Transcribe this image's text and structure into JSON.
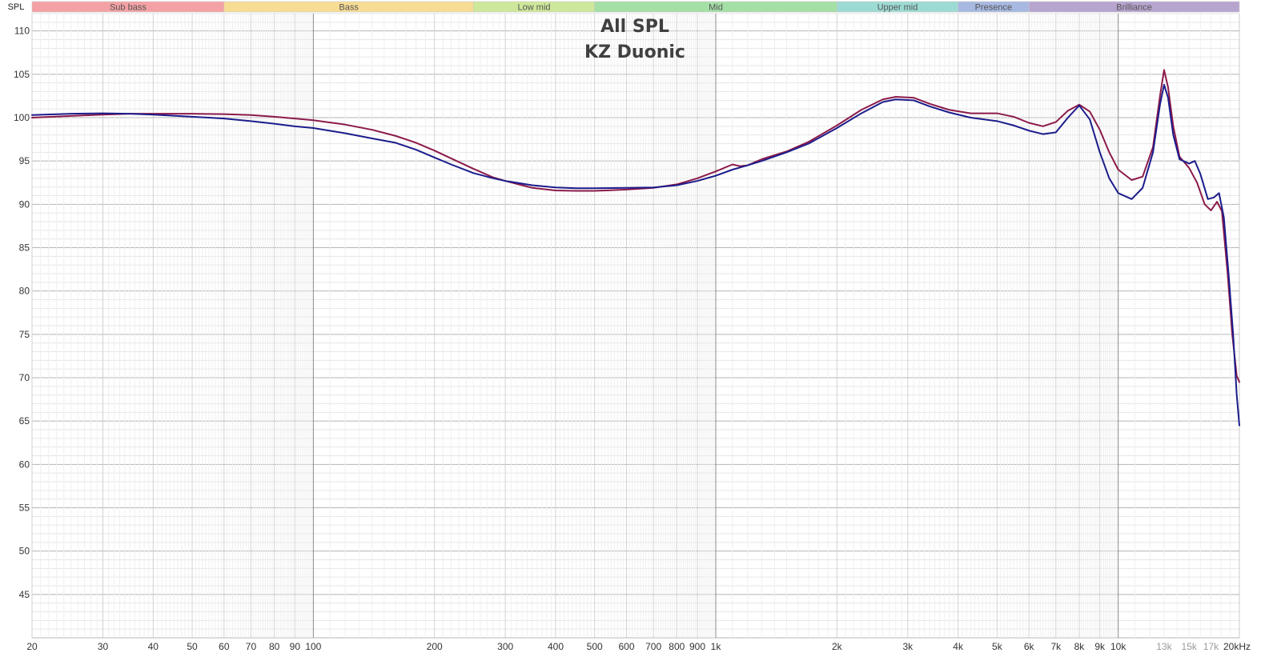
{
  "chart_data": {
    "type": "line",
    "title": "All SPL",
    "subtitle": "KZ Duonic",
    "ylabel": "SPL",
    "x_scale": "log",
    "xlim": [
      20,
      20000
    ],
    "ylim": [
      40,
      112
    ],
    "grid": true,
    "y_ticks": [
      45,
      50,
      55,
      60,
      65,
      70,
      75,
      80,
      85,
      90,
      95,
      100,
      105,
      110
    ],
    "x_ticks": [
      {
        "value": 20,
        "label": "20"
      },
      {
        "value": 30,
        "label": "30"
      },
      {
        "value": 40,
        "label": "40"
      },
      {
        "value": 50,
        "label": "50"
      },
      {
        "value": 60,
        "label": "60"
      },
      {
        "value": 70,
        "label": "70"
      },
      {
        "value": 80,
        "label": "80"
      },
      {
        "value": 90,
        "label": "90"
      },
      {
        "value": 100,
        "label": "100"
      },
      {
        "value": 200,
        "label": "200"
      },
      {
        "value": 300,
        "label": "300"
      },
      {
        "value": 400,
        "label": "400"
      },
      {
        "value": 500,
        "label": "500"
      },
      {
        "value": 600,
        "label": "600"
      },
      {
        "value": 700,
        "label": "700"
      },
      {
        "value": 800,
        "label": "800"
      },
      {
        "value": 900,
        "label": "900"
      },
      {
        "value": 1000,
        "label": "1k"
      },
      {
        "value": 2000,
        "label": "2k"
      },
      {
        "value": 3000,
        "label": "3k"
      },
      {
        "value": 4000,
        "label": "4k"
      },
      {
        "value": 5000,
        "label": "5k"
      },
      {
        "value": 6000,
        "label": "6k"
      },
      {
        "value": 7000,
        "label": "7k"
      },
      {
        "value": 8000,
        "label": "8k"
      },
      {
        "value": 9000,
        "label": "9k"
      },
      {
        "value": 10000,
        "label": "10k"
      },
      {
        "value": 13000,
        "label": "13k",
        "faint": true
      },
      {
        "value": 15000,
        "label": "15k",
        "faint": true
      },
      {
        "value": 17000,
        "label": "17k",
        "faint": true
      },
      {
        "value": 20000,
        "label": "20kHz"
      }
    ],
    "bands": [
      {
        "name": "Sub bass",
        "from": 20,
        "to": 60,
        "color": "#f4a1a5"
      },
      {
        "name": "Bass",
        "from": 60,
        "to": 250,
        "color": "#f7dc94"
      },
      {
        "name": "Low mid",
        "from": 250,
        "to": 500,
        "color": "#cde89a"
      },
      {
        "name": "Mid",
        "from": 500,
        "to": 2000,
        "color": "#a4dfa6"
      },
      {
        "name": "Upper mid",
        "from": 2000,
        "to": 4000,
        "color": "#9cdbd3"
      },
      {
        "name": "Presence",
        "from": 4000,
        "to": 6000,
        "color": "#a7b8e1"
      },
      {
        "name": "Brilliance",
        "from": 6000,
        "to": 20000,
        "color": "#b7a4cf"
      }
    ],
    "series": [
      {
        "color": "#8b1a4a",
        "points": [
          [
            20,
            100.0
          ],
          [
            25,
            100.2
          ],
          [
            30,
            100.35
          ],
          [
            35,
            100.45
          ],
          [
            40,
            100.45
          ],
          [
            50,
            100.45
          ],
          [
            60,
            100.4
          ],
          [
            70,
            100.3
          ],
          [
            80,
            100.1
          ],
          [
            90,
            99.9
          ],
          [
            100,
            99.7
          ],
          [
            120,
            99.2
          ],
          [
            140,
            98.6
          ],
          [
            160,
            97.9
          ],
          [
            180,
            97.1
          ],
          [
            200,
            96.2
          ],
          [
            220,
            95.3
          ],
          [
            250,
            94.1
          ],
          [
            280,
            93.1
          ],
          [
            300,
            92.7
          ],
          [
            350,
            91.9
          ],
          [
            400,
            91.6
          ],
          [
            450,
            91.55
          ],
          [
            500,
            91.55
          ],
          [
            600,
            91.7
          ],
          [
            700,
            91.9
          ],
          [
            800,
            92.3
          ],
          [
            900,
            93.0
          ],
          [
            1000,
            93.8
          ],
          [
            1100,
            94.6
          ],
          [
            1150,
            94.4
          ],
          [
            1200,
            94.5
          ],
          [
            1300,
            95.2
          ],
          [
            1500,
            96.1
          ],
          [
            1700,
            97.2
          ],
          [
            2000,
            99.1
          ],
          [
            2300,
            100.9
          ],
          [
            2600,
            102.1
          ],
          [
            2800,
            102.4
          ],
          [
            3100,
            102.3
          ],
          [
            3400,
            101.6
          ],
          [
            3800,
            100.9
          ],
          [
            4300,
            100.5
          ],
          [
            5000,
            100.5
          ],
          [
            5500,
            100.1
          ],
          [
            6000,
            99.4
          ],
          [
            6500,
            99.0
          ],
          [
            7000,
            99.5
          ],
          [
            7500,
            100.8
          ],
          [
            8000,
            101.5
          ],
          [
            8500,
            100.7
          ],
          [
            9000,
            98.6
          ],
          [
            9500,
            96.0
          ],
          [
            10000,
            94.0
          ],
          [
            10800,
            92.8
          ],
          [
            11500,
            93.2
          ],
          [
            12200,
            96.6
          ],
          [
            12700,
            102.5
          ],
          [
            13000,
            105.5
          ],
          [
            13300,
            103.5
          ],
          [
            13700,
            99.0
          ],
          [
            14200,
            95.5
          ],
          [
            15000,
            94.2
          ],
          [
            15700,
            92.5
          ],
          [
            16400,
            90.0
          ],
          [
            17000,
            89.3
          ],
          [
            17600,
            90.3
          ],
          [
            18100,
            89.2
          ],
          [
            18700,
            82.0
          ],
          [
            19200,
            75.0
          ],
          [
            19700,
            70.2
          ],
          [
            20000,
            69.5
          ]
        ]
      },
      {
        "color": "#1c1c8c",
        "points": [
          [
            20,
            100.3
          ],
          [
            25,
            100.45
          ],
          [
            30,
            100.5
          ],
          [
            35,
            100.45
          ],
          [
            40,
            100.35
          ],
          [
            50,
            100.1
          ],
          [
            60,
            99.9
          ],
          [
            70,
            99.6
          ],
          [
            80,
            99.3
          ],
          [
            90,
            99.0
          ],
          [
            100,
            98.8
          ],
          [
            120,
            98.2
          ],
          [
            140,
            97.6
          ],
          [
            160,
            97.1
          ],
          [
            180,
            96.3
          ],
          [
            200,
            95.4
          ],
          [
            220,
            94.6
          ],
          [
            250,
            93.6
          ],
          [
            280,
            93.0
          ],
          [
            300,
            92.7
          ],
          [
            350,
            92.2
          ],
          [
            400,
            91.95
          ],
          [
            450,
            91.85
          ],
          [
            500,
            91.85
          ],
          [
            600,
            91.9
          ],
          [
            700,
            91.95
          ],
          [
            800,
            92.2
          ],
          [
            900,
            92.7
          ],
          [
            1000,
            93.3
          ],
          [
            1100,
            94.0
          ],
          [
            1200,
            94.5
          ],
          [
            1300,
            95.0
          ],
          [
            1500,
            96.0
          ],
          [
            1700,
            97.0
          ],
          [
            2000,
            98.8
          ],
          [
            2300,
            100.5
          ],
          [
            2600,
            101.8
          ],
          [
            2800,
            102.1
          ],
          [
            3100,
            102.0
          ],
          [
            3400,
            101.3
          ],
          [
            3800,
            100.6
          ],
          [
            4300,
            100.0
          ],
          [
            5000,
            99.6
          ],
          [
            5500,
            99.1
          ],
          [
            6000,
            98.5
          ],
          [
            6500,
            98.1
          ],
          [
            7000,
            98.3
          ],
          [
            7500,
            100.0
          ],
          [
            8000,
            101.4
          ],
          [
            8500,
            99.8
          ],
          [
            9000,
            96.0
          ],
          [
            9500,
            93.0
          ],
          [
            10000,
            91.3
          ],
          [
            10800,
            90.6
          ],
          [
            11500,
            91.9
          ],
          [
            12200,
            96.0
          ],
          [
            12700,
            101.5
          ],
          [
            13000,
            103.8
          ],
          [
            13300,
            102.3
          ],
          [
            13700,
            98.0
          ],
          [
            14200,
            95.2
          ],
          [
            15000,
            94.7
          ],
          [
            15500,
            95.0
          ],
          [
            16000,
            93.5
          ],
          [
            16700,
            90.6
          ],
          [
            17300,
            90.8
          ],
          [
            17800,
            91.3
          ],
          [
            18300,
            88.5
          ],
          [
            18800,
            82.0
          ],
          [
            19300,
            75.0
          ],
          [
            19700,
            68.0
          ],
          [
            20000,
            64.5
          ]
        ]
      }
    ]
  }
}
